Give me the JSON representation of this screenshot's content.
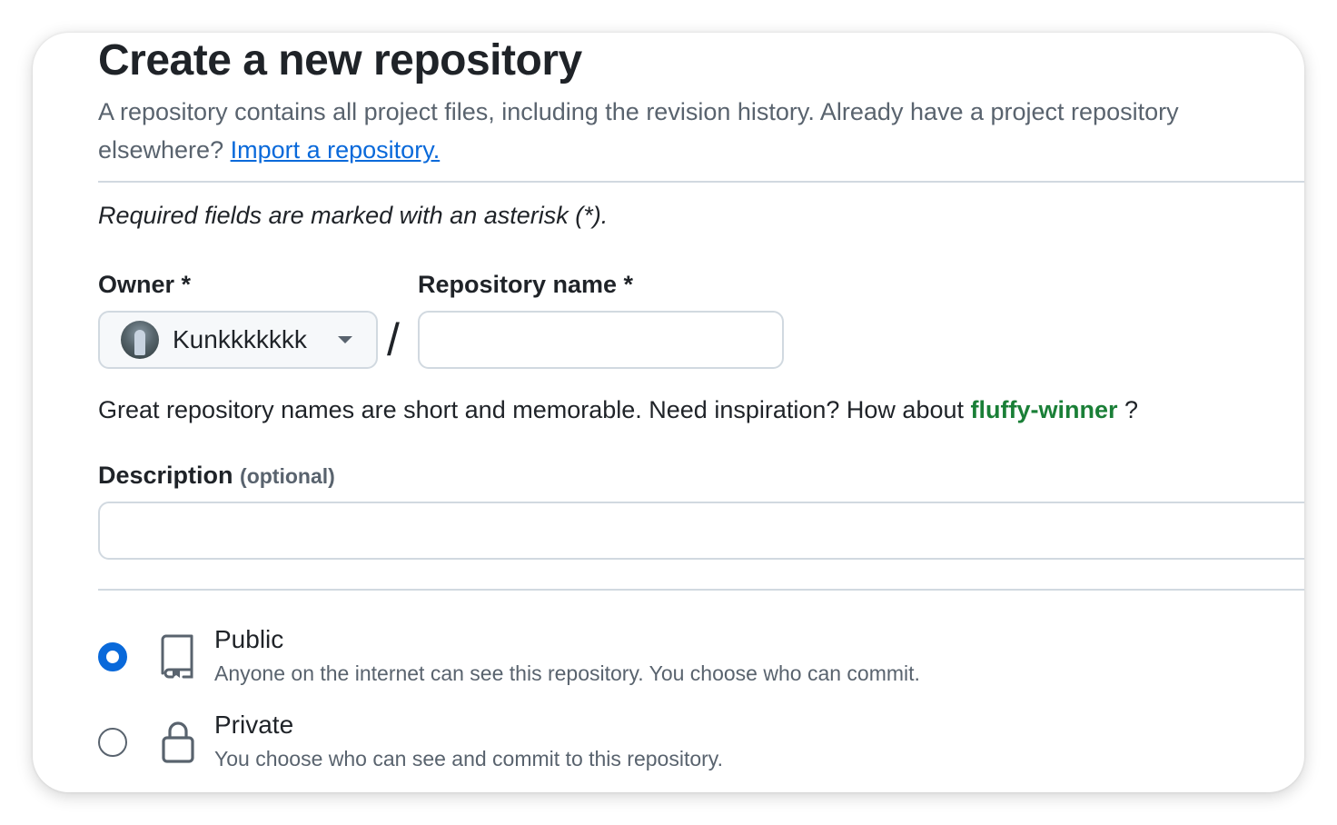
{
  "header": {
    "title": "Create a new repository",
    "subtitle_text": "A repository contains all project files, including the revision history. Already have a project repository elsewhere?",
    "import_link": "Import a repository."
  },
  "form": {
    "required_note": "Required fields are marked with an asterisk (*).",
    "owner": {
      "label": "Owner *",
      "value": "Kunkkkkkkk"
    },
    "separator": "/",
    "repo_name": {
      "label": "Repository name *",
      "value": ""
    },
    "name_hint": {
      "text": "Great repository names are short and memorable. Need inspiration? How about",
      "suggestion": "fluffy-winner",
      "suffix": "?"
    },
    "description": {
      "label": "Description",
      "optional": "(optional)",
      "value": ""
    },
    "visibility": [
      {
        "title": "Public",
        "description": "Anyone on the internet can see this repository. You choose who can commit.",
        "icon": "repo-icon",
        "selected": true
      },
      {
        "title": "Private",
        "description": "You choose who can see and commit to this repository.",
        "icon": "lock-icon",
        "selected": false
      }
    ]
  },
  "colors": {
    "accent": "#0969da",
    "suggestion": "#1a7f37",
    "muted": "#59636e",
    "border": "#d1d9e0"
  }
}
